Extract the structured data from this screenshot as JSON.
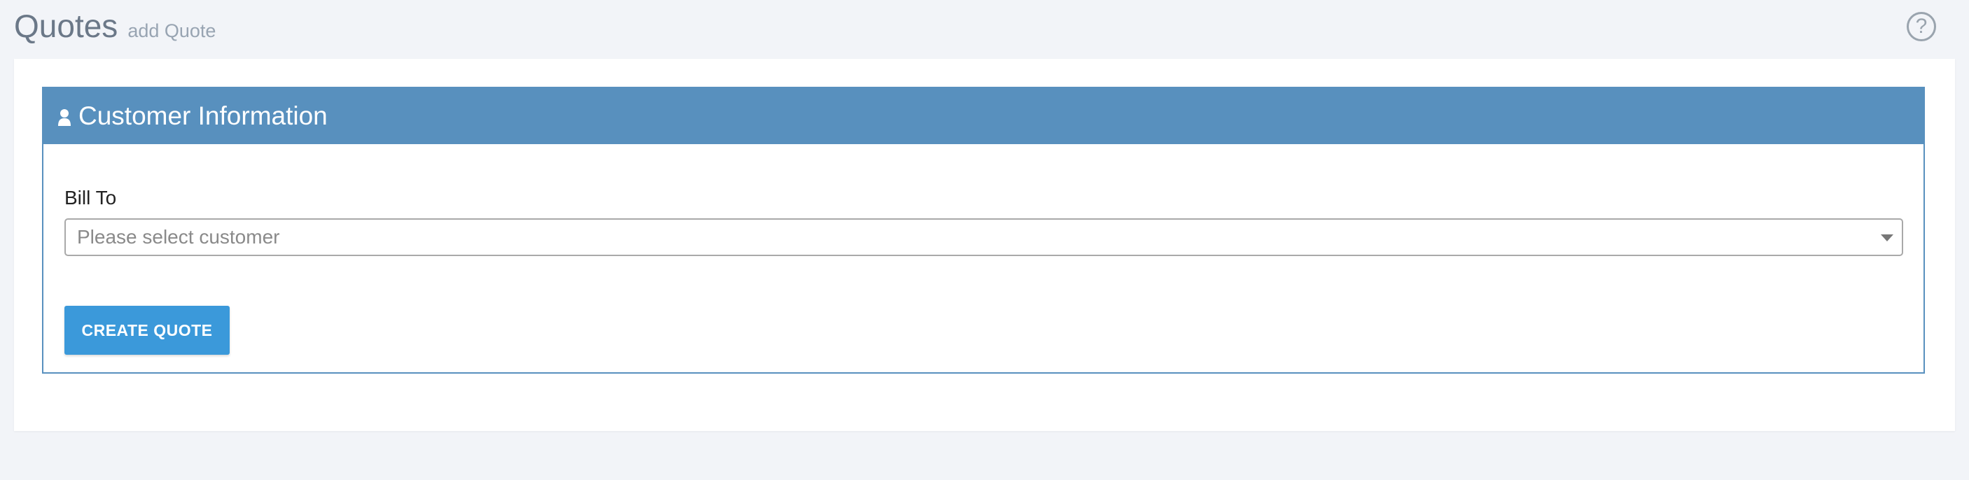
{
  "header": {
    "title": "Quotes",
    "subtitle": "add Quote",
    "help_icon": "question-circle-icon",
    "help_glyph": "?"
  },
  "panel": {
    "title": "Customer Information",
    "icon": "user-icon",
    "accent_color": "#5890be"
  },
  "form": {
    "bill_to_label": "Bill To",
    "customer_select": {
      "placeholder": "Please select customer",
      "value": ""
    },
    "submit_label": "CREATE QUOTE",
    "submit_color": "#3b99da"
  }
}
